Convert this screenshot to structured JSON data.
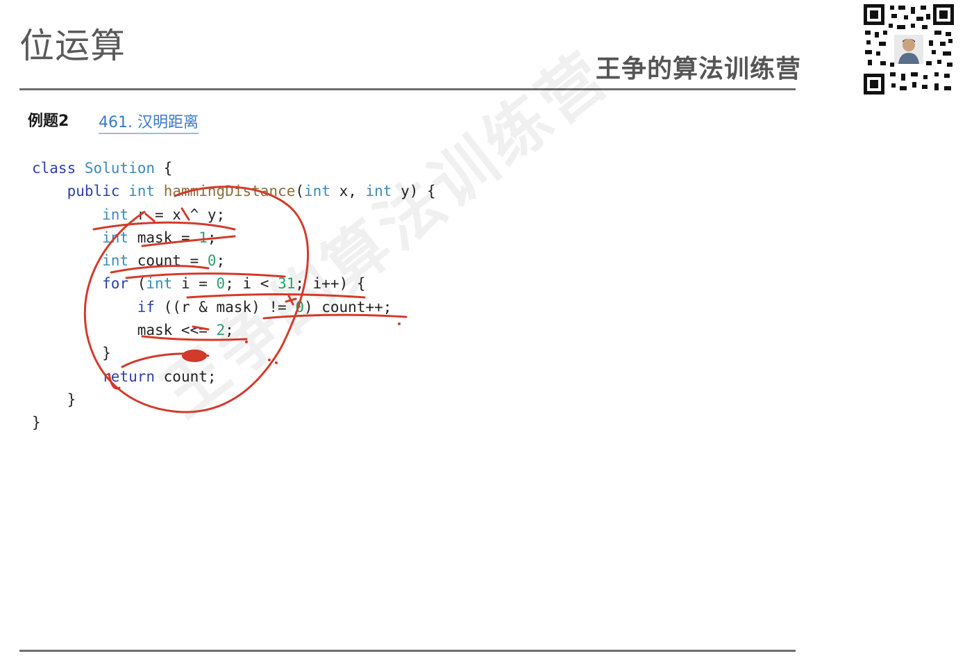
{
  "slide": {
    "title": "位运算",
    "brand": "王争的算法训练营",
    "example_label": "例题2",
    "problem_link": "461. 汉明距离",
    "watermark": "王争的算法训练营"
  },
  "code": {
    "l1": {
      "kw": "class",
      "cls": "Solution",
      "rest": " {"
    },
    "l2": {
      "kw": "public",
      "ty": "int",
      "fn": "hammingDistance",
      "p1": "(",
      "t1": "int",
      "p2": " x, ",
      "t2": "int",
      "p3": " y) {"
    },
    "l3": {
      "ty": "int",
      "rest": " r = x ^ y;"
    },
    "l4": {
      "ty": "int",
      "mid": " mask = ",
      "num": "1",
      "end": ";"
    },
    "l5": {
      "ty": "int",
      "mid": " count = ",
      "num": "0",
      "end": ";"
    },
    "l6": {
      "kw": "for",
      "p1": " (",
      "ty": "int",
      "p2": " i = ",
      "n1": "0",
      "p3": "; i < ",
      "n2": "31",
      "p4": "; i++) {"
    },
    "l7": {
      "kw": "if",
      "p1": " ((r & mask) != ",
      "num": "0",
      "p2": ") count++;"
    },
    "l8": {
      "mid": "mask <<= ",
      "num": "2",
      "end": ";"
    },
    "l9": "}",
    "l10": {
      "kw": "return",
      "rest": " count;"
    },
    "l11": "}",
    "l12": "}"
  },
  "colors": {
    "keyword": "#2b3fae",
    "type": "#3b8ab8",
    "function": "#8a6d3b",
    "number": "#2e9e6e",
    "link": "#3a79c9",
    "annotation_ink": "#d23a2a"
  },
  "icons": {
    "qr": "qr-code-icon",
    "avatar": "avatar-icon"
  }
}
